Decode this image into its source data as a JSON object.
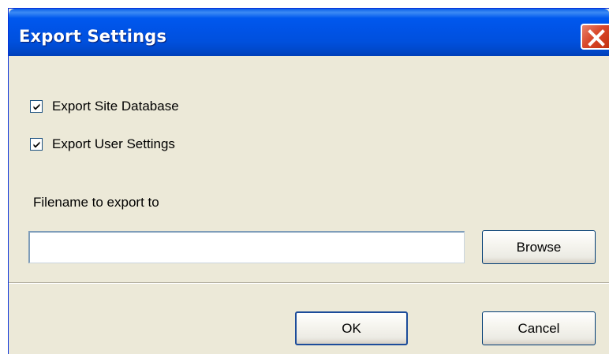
{
  "window": {
    "title": "Export Settings"
  },
  "options": {
    "export_site_database": {
      "label": "Export Site Database",
      "checked": true
    },
    "export_user_settings": {
      "label": "Export User Settings",
      "checked": true
    }
  },
  "filename": {
    "label": "Filename to export to",
    "value": "",
    "placeholder": ""
  },
  "buttons": {
    "browse": "Browse",
    "ok": "OK",
    "cancel": "Cancel"
  },
  "icons": {
    "close": "close-icon",
    "check": "checkmark-icon"
  },
  "colors": {
    "titlebar": "#0054e3",
    "close_button": "#d9482b",
    "dialog_bg": "#ece9d8"
  }
}
